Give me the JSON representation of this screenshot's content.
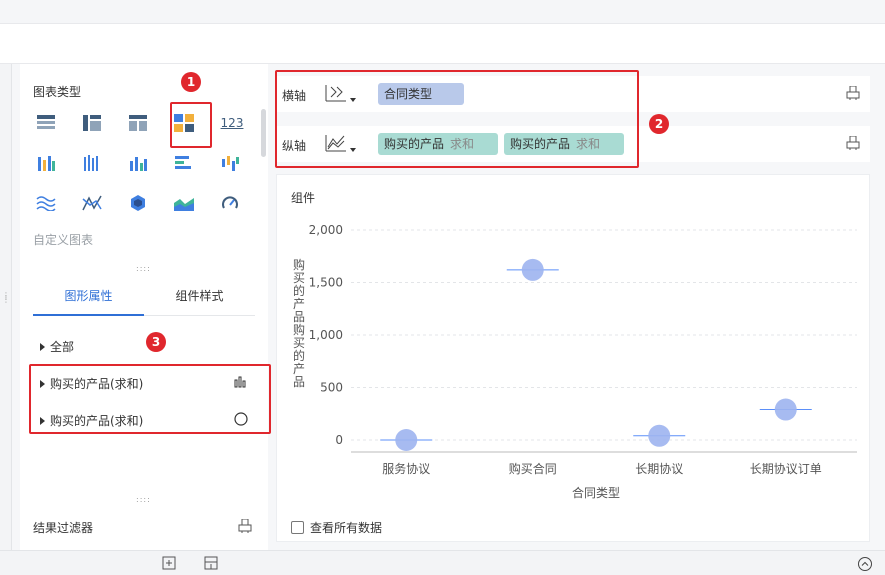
{
  "left_panel": {
    "chart_type_title": "图表类型",
    "custom_chart": "自定义图表",
    "tabs": [
      "图形属性",
      "组件样式"
    ],
    "properties": [
      {
        "label": "全部"
      },
      {
        "label": "购买的产品(求和)",
        "icon": "bar-chart-icon"
      },
      {
        "label": "购买的产品(求和)",
        "icon": "circle-icon"
      }
    ],
    "filter_title": "结果过滤器",
    "icon_text_123": "123"
  },
  "axes": {
    "x": {
      "label": "横轴",
      "fields": [
        {
          "name": "合同类型"
        }
      ]
    },
    "y": {
      "label": "纵轴",
      "fields": [
        {
          "name": "购买的产品",
          "agg": "求和"
        },
        {
          "name": "购买的产品",
          "agg": "求和"
        }
      ]
    }
  },
  "badges": [
    "1",
    "2",
    "3"
  ],
  "card": {
    "title": "组件",
    "show_all": "查看所有数据"
  },
  "chart_data": {
    "type": "scatter",
    "categories": [
      "服务协议",
      "购买合同",
      "长期协议",
      "长期协议订单"
    ],
    "series": [
      {
        "values": [
          0,
          1620,
          40,
          290
        ]
      }
    ],
    "ylim": [
      0,
      2000
    ],
    "yticks": [
      "0",
      "500",
      "1,000",
      "1,500",
      "2,000"
    ],
    "xlabel": "合同类型",
    "ylabel": "购买的产品 购买的产品",
    "grid": true,
    "colors": {
      "marker": "#9db4f0",
      "line": "#5b8ff9"
    }
  },
  "colors": {
    "accent": "#2f6fd6",
    "highlight": "#e0272d"
  }
}
